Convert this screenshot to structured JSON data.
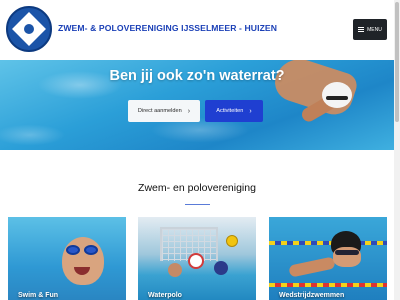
{
  "header": {
    "site_title": "ZWEM- & POLOVERENIGING IJSSELMEER - HUIZEN",
    "menu_label": "MENU"
  },
  "hero": {
    "title": "Ben jij ook zo'n waterrat?",
    "primary_button": "Direct aanmelden",
    "secondary_button": "Activiteiten",
    "chevron": "›"
  },
  "section": {
    "title": "Zwem- en polovereniging"
  },
  "cards": [
    {
      "label": "Swim & Fun"
    },
    {
      "label": "Waterpolo"
    },
    {
      "label": "Wedstrijdzwemmen"
    }
  ],
  "colors": {
    "brand_blue": "#1a3fb6",
    "button_blue": "#1f3fd1",
    "menu_dark": "#1f2328"
  },
  "icons": {
    "menu": "hamburger-icon",
    "arrow": "chevron-right-icon"
  }
}
